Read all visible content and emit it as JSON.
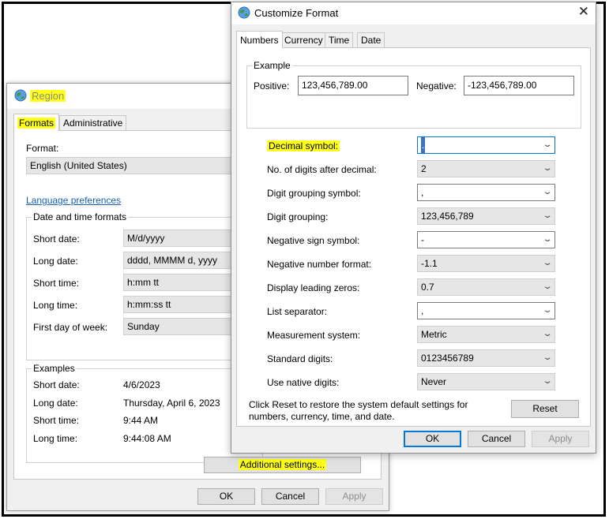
{
  "region": {
    "title": "Region",
    "tabs": [
      {
        "label": "Formats",
        "active": true
      },
      {
        "label": "Administrative",
        "active": false
      }
    ],
    "format_label": "Format:",
    "format_value": "English (United States)",
    "language_link": "Language preferences",
    "datetime_group_title": "Date and time formats",
    "datetime_rows": [
      {
        "label": "Short date:",
        "value": "M/d/yyyy"
      },
      {
        "label": "Long date:",
        "value": "dddd, MMMM d, yyyy"
      },
      {
        "label": "Short time:",
        "value": "h:mm tt"
      },
      {
        "label": "Long time:",
        "value": "h:mm:ss tt"
      },
      {
        "label": "First day of week:",
        "value": "Sunday"
      }
    ],
    "examples_group_title": "Examples",
    "example_rows": [
      {
        "label": "Short date:",
        "value": "4/6/2023"
      },
      {
        "label": "Long date:",
        "value": "Thursday, April 6, 2023"
      },
      {
        "label": "Short time:",
        "value": "9:44 AM"
      },
      {
        "label": "Long time:",
        "value": "9:44:08 AM"
      }
    ],
    "additional_settings_label": "Additional settings...",
    "ok_label": "OK",
    "cancel_label": "Cancel",
    "apply_label": "Apply"
  },
  "customize": {
    "title": "Customize Format",
    "close_glyph": "✕",
    "tabs": [
      {
        "label": "Numbers",
        "active": true
      },
      {
        "label": "Currency",
        "active": false
      },
      {
        "label": "Time",
        "active": false
      },
      {
        "label": "Date",
        "active": false
      }
    ],
    "example_group_title": "Example",
    "positive_label": "Positive:",
    "positive_value": "123,456,789.00",
    "negative_label": "Negative:",
    "negative_value": "-123,456,789.00",
    "settings": [
      {
        "label": "Decimal symbol:",
        "value": ".",
        "editable": true,
        "highlighted": true,
        "focused": true
      },
      {
        "label": "No. of digits after decimal:",
        "value": "2",
        "editable": false
      },
      {
        "label": "Digit grouping symbol:",
        "value": ",",
        "editable": true
      },
      {
        "label": "Digit grouping:",
        "value": "123,456,789",
        "editable": false
      },
      {
        "label": "Negative sign symbol:",
        "value": "-",
        "editable": true
      },
      {
        "label": "Negative number format:",
        "value": "-1.1",
        "editable": false
      },
      {
        "label": "Display leading zeros:",
        "value": "0.7",
        "editable": false
      },
      {
        "label": "List separator:",
        "value": ",",
        "editable": true
      },
      {
        "label": "Measurement system:",
        "value": "Metric",
        "editable": false
      },
      {
        "label": "Standard digits:",
        "value": "0123456789",
        "editable": false
      },
      {
        "label": "Use native digits:",
        "value": "Never",
        "editable": false
      }
    ],
    "reset_text_line1": "Click Reset to restore the system default settings for",
    "reset_text_line2": "numbers, currency, time, and date.",
    "reset_label": "Reset",
    "ok_label": "OK",
    "cancel_label": "Cancel",
    "apply_label": "Apply"
  },
  "colors": {
    "highlight": "#ffff1a",
    "accent": "#0078d7",
    "link": "#1a5fb4"
  },
  "icons": {
    "region_window": "globe-icon",
    "customize_window": "globe-icon",
    "dropdown": "chevron-down-icon",
    "close": "close-icon"
  }
}
